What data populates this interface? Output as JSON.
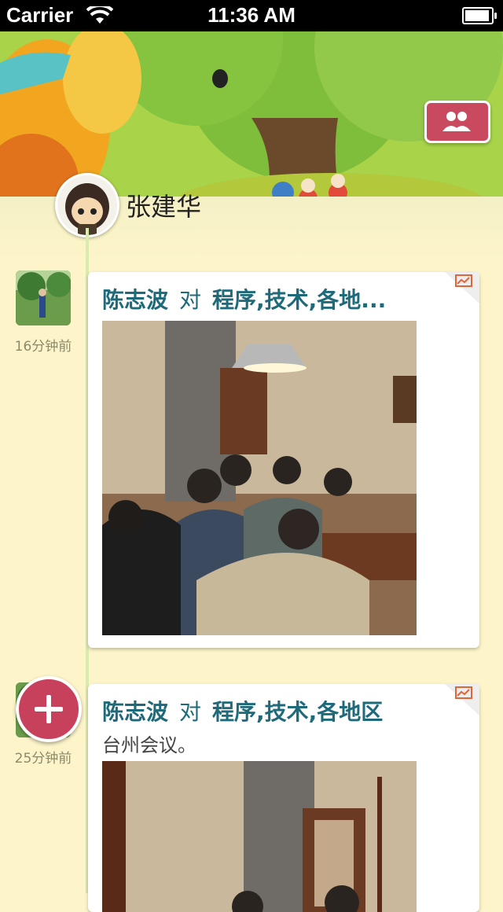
{
  "status_bar": {
    "carrier": "Carrier",
    "time": "11:36 AM"
  },
  "profile": {
    "name": "张建华"
  },
  "posts": [
    {
      "time": "16分钟前",
      "author": "陈志波",
      "verb": "对",
      "topic": "程序,技术,各地...",
      "content": ""
    },
    {
      "time": "25分钟前",
      "author": "陈志波",
      "verb": "对",
      "topic": "程序,技术,各地区",
      "content": "台州会议。"
    }
  ],
  "icons": {
    "group": "group-people-icon",
    "add": "plus-icon",
    "corner": "chart-share-icon"
  },
  "colors": {
    "accent": "#c8415c",
    "title": "#1f6a7a",
    "timeline": "#d7ecae",
    "background": "#fdf5c9"
  }
}
